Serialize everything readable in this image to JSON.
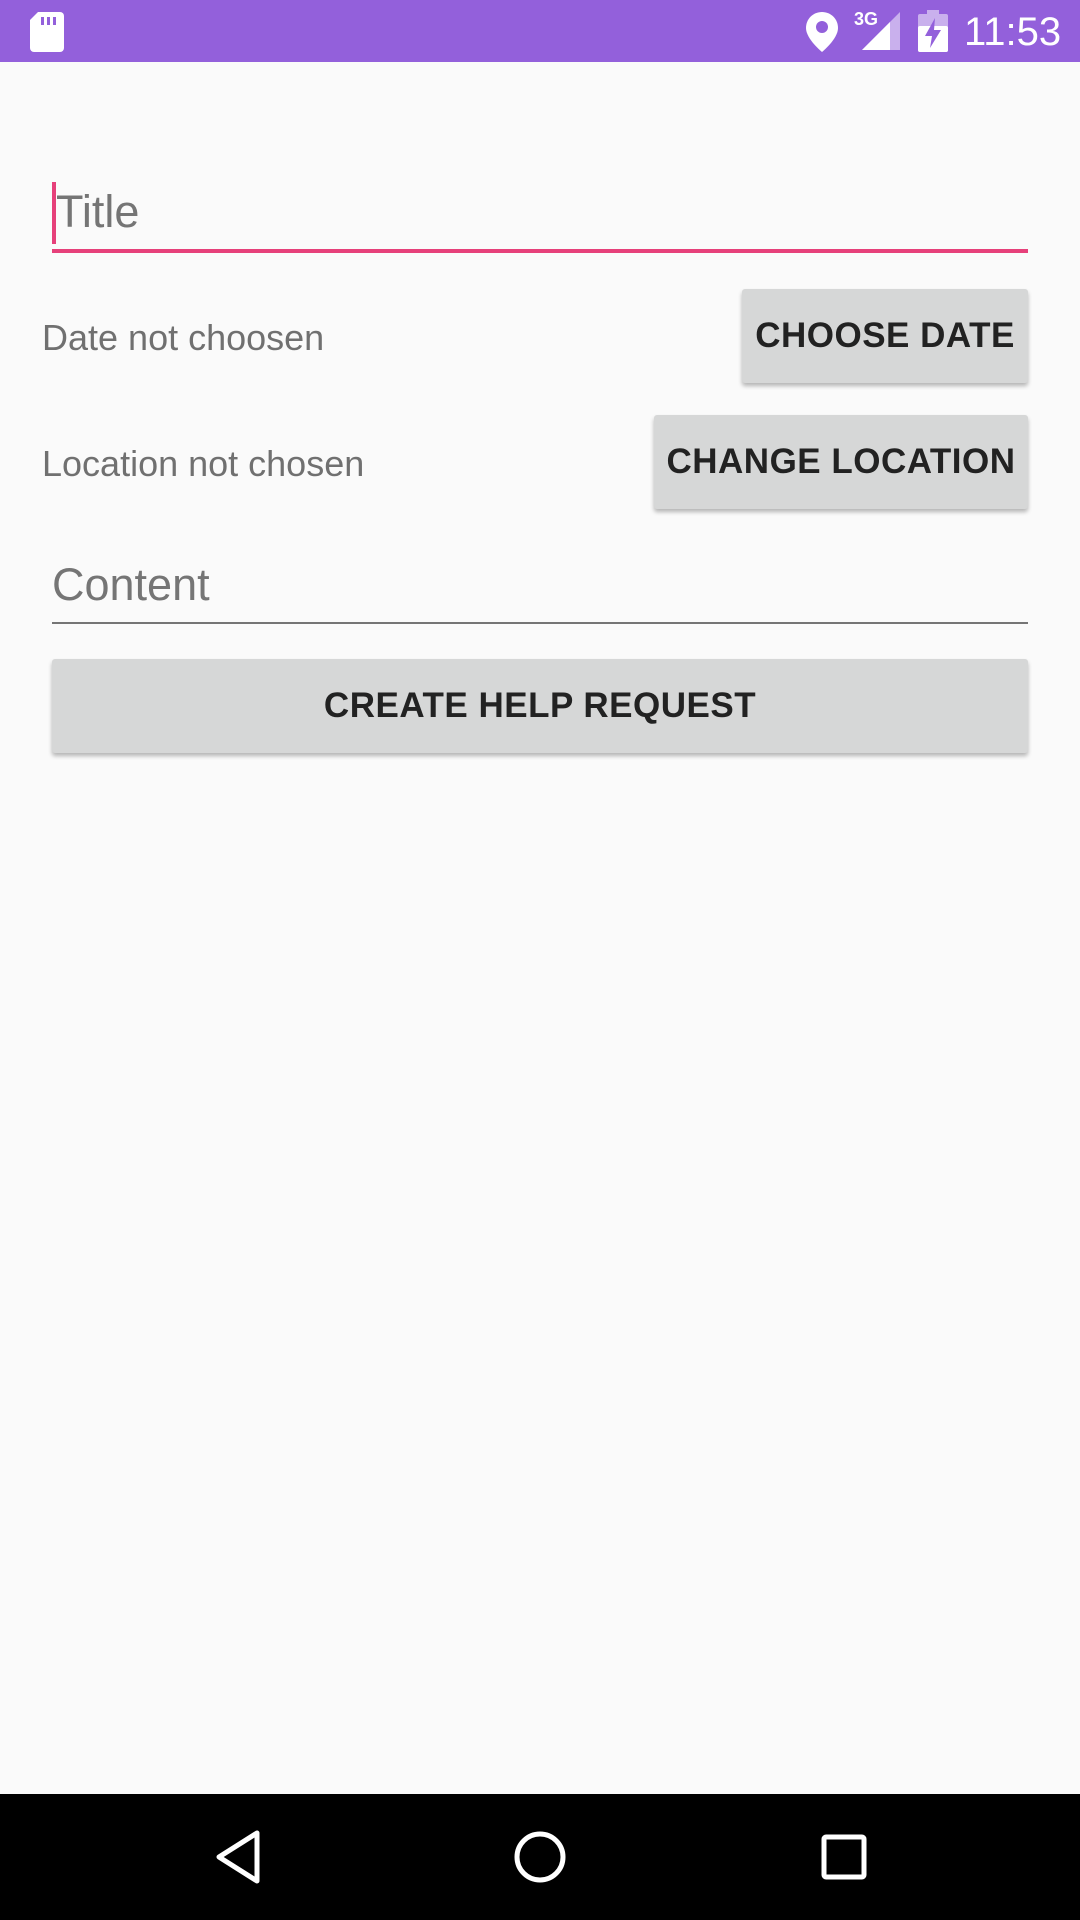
{
  "status_bar": {
    "time": "11:53",
    "network_type": "3G",
    "icons": [
      "sd-card-icon",
      "location-icon",
      "cell-signal-icon",
      "battery-charging-icon"
    ]
  },
  "form": {
    "title_placeholder": "Title",
    "title_value": "",
    "date_status": "Date not choosen",
    "choose_date_label": "CHOOSE DATE",
    "location_status": "Location not chosen",
    "change_location_label": "CHANGE LOCATION",
    "content_placeholder": "Content",
    "content_value": "",
    "create_button_label": "CREATE HELP REQUEST"
  },
  "nav_bar": {
    "icons": [
      "back-icon",
      "home-icon",
      "recents-icon"
    ]
  },
  "colors": {
    "status_bar": "#9360db",
    "accent": "#e6407a",
    "background": "#fafafa",
    "button": "#d6d7d7",
    "nav_bar": "#000000"
  }
}
